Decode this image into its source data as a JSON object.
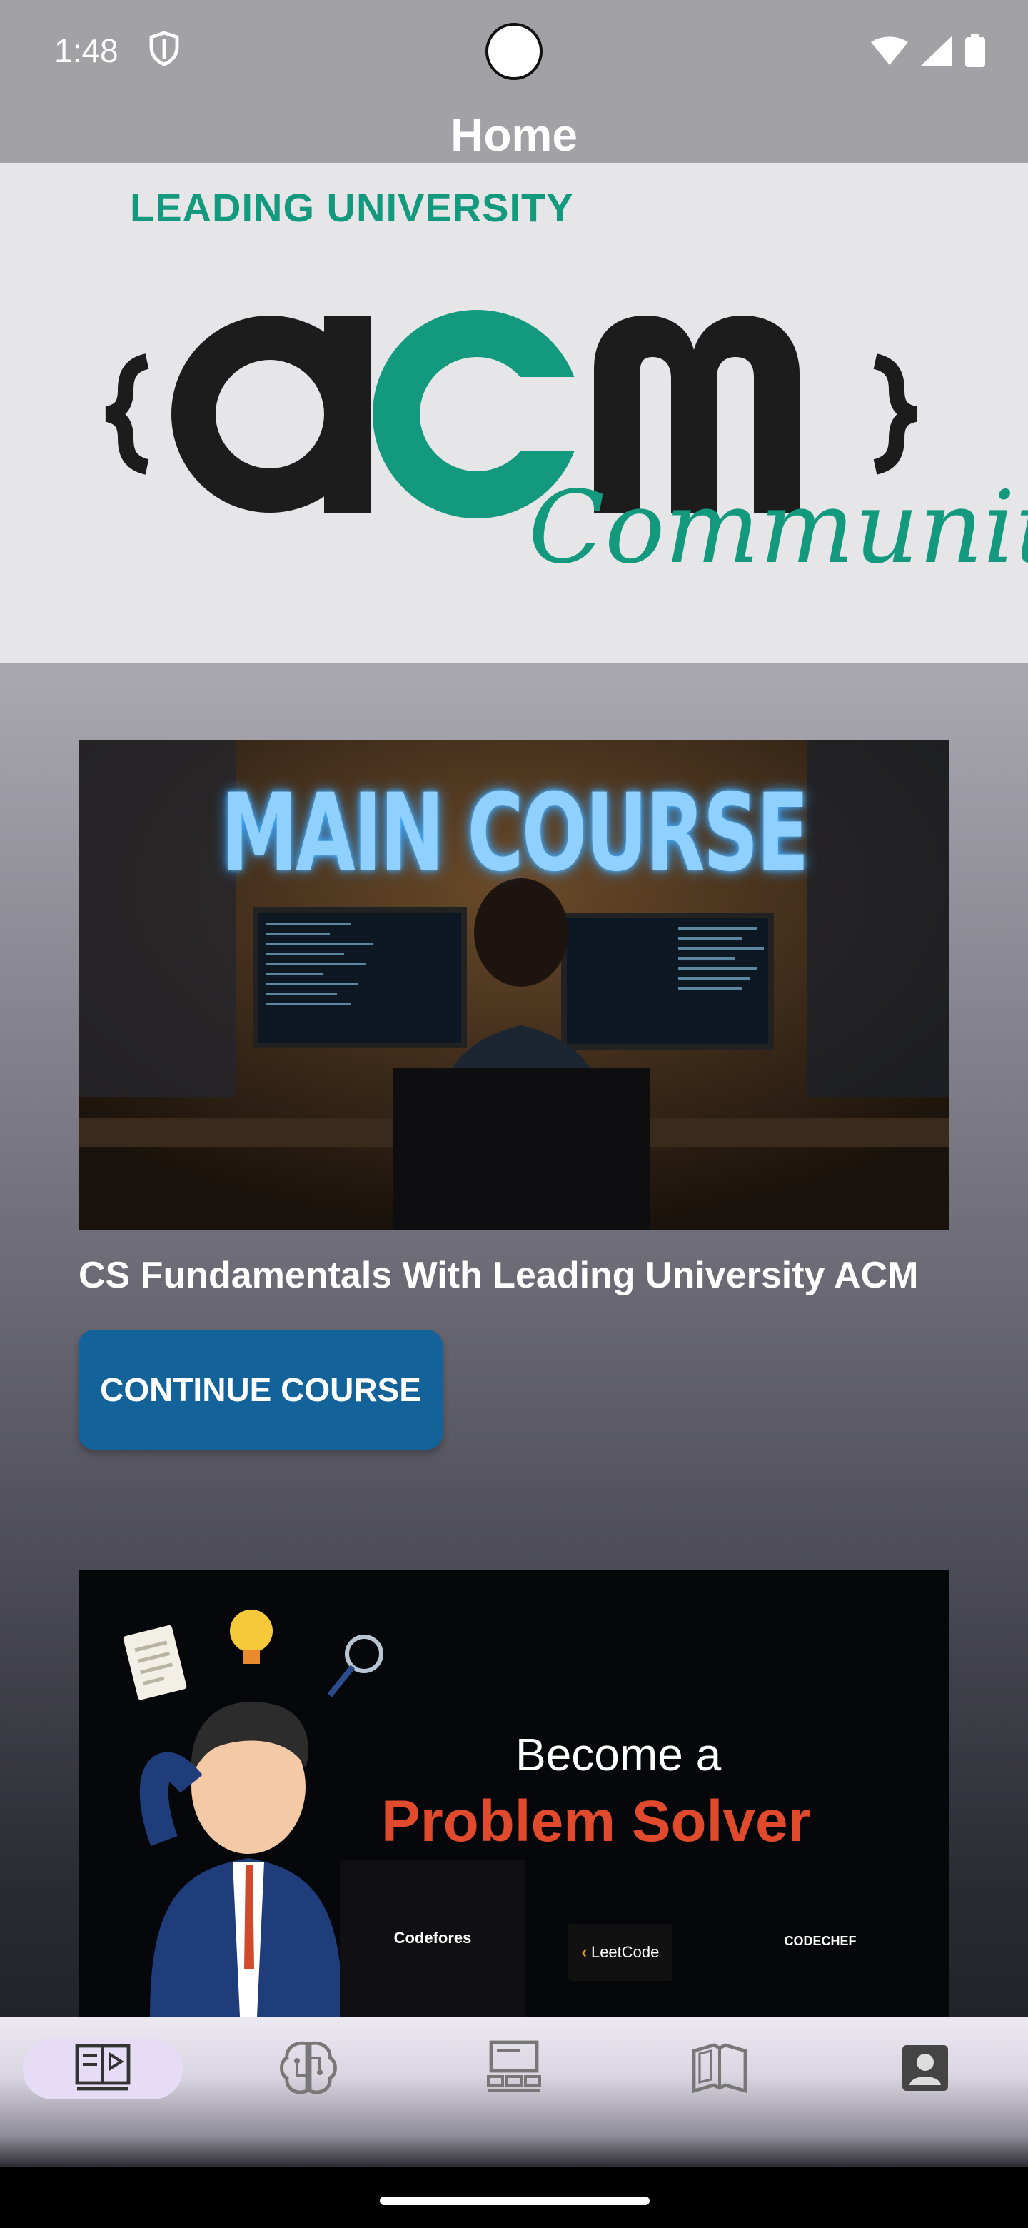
{
  "status_bar": {
    "time": "1:48"
  },
  "app_bar": {
    "title": "Home"
  },
  "banner": {
    "university": "LEADING UNIVERSITY",
    "logo_text": "acm",
    "script_text": "Community",
    "colors": {
      "dark": "#1c1c1c",
      "green": "#139a7e",
      "background": "#e6e6e8"
    }
  },
  "main_course": {
    "image_title": "MAIN COURSE",
    "caption": "CS Fundamentals With Leading University ACM",
    "button_label": "CONTINUE COURSE",
    "button_color": "#14629a"
  },
  "problem_solver": {
    "line1": "Become a",
    "line2": "Problem Solver",
    "logos": {
      "codeforces": "Codefores",
      "leetcode": "LeetCode",
      "codechef": "CODECHEF"
    }
  },
  "bottom_nav": {
    "items": [
      {
        "icon": "course-book-icon",
        "active": true
      },
      {
        "icon": "brain-icon",
        "active": false
      },
      {
        "icon": "classroom-icon",
        "active": false
      },
      {
        "icon": "open-book-icon",
        "active": false
      },
      {
        "icon": "profile-icon",
        "active": false
      }
    ]
  }
}
